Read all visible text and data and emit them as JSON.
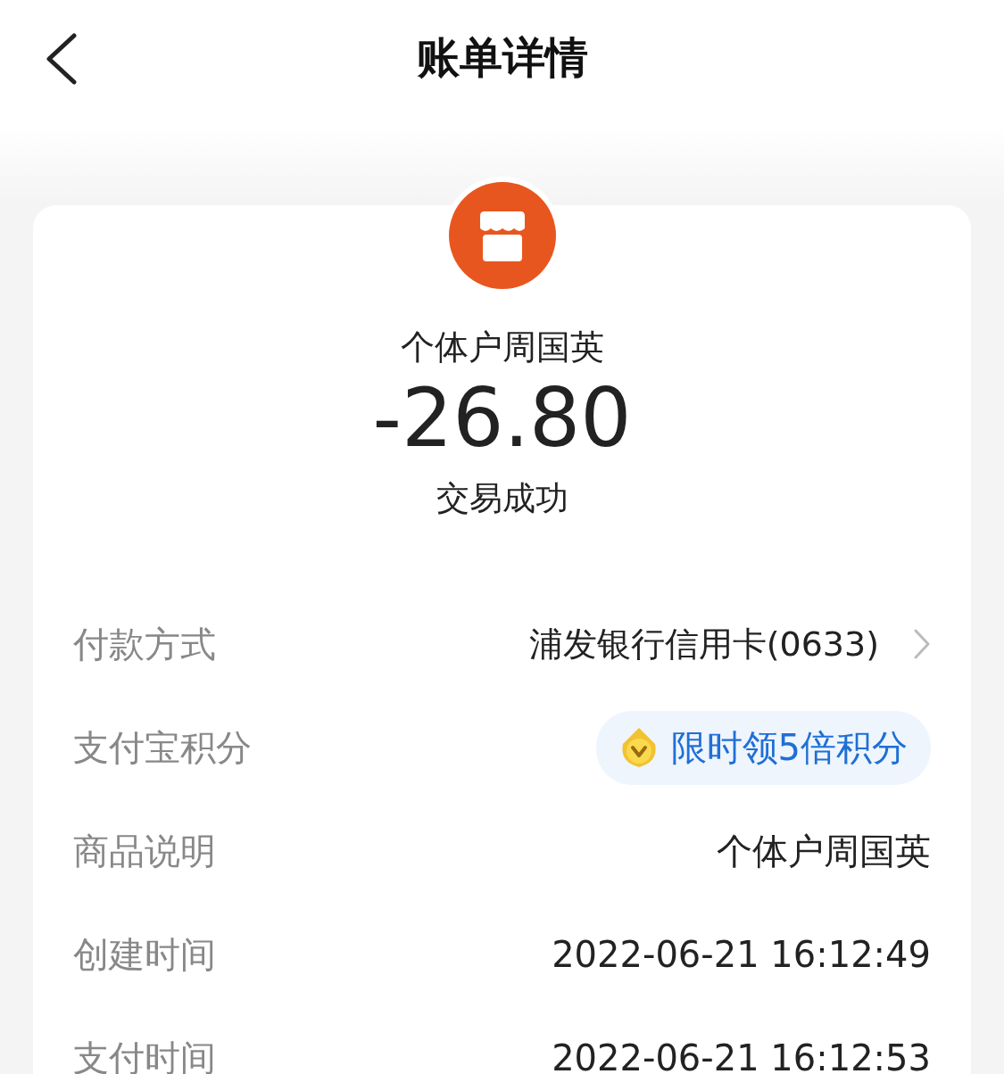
{
  "header": {
    "title": "账单详情"
  },
  "merchant": {
    "name": "个体户周国英",
    "amount": "-26.80",
    "status": "交易成功"
  },
  "rows": [
    {
      "kind": "link",
      "label": "付款方式",
      "value": "浦发银行信用卡(0633)"
    },
    {
      "kind": "badge",
      "label": "支付宝积分",
      "value": "限时领5倍积分"
    },
    {
      "kind": "text",
      "label": "商品说明",
      "value": "个体户周国英"
    },
    {
      "kind": "text",
      "label": "创建时间",
      "value": "2022-06-21 16:12:49"
    },
    {
      "kind": "text",
      "label": "支付时间",
      "value": "2022-06-21 16:12:53"
    }
  ]
}
